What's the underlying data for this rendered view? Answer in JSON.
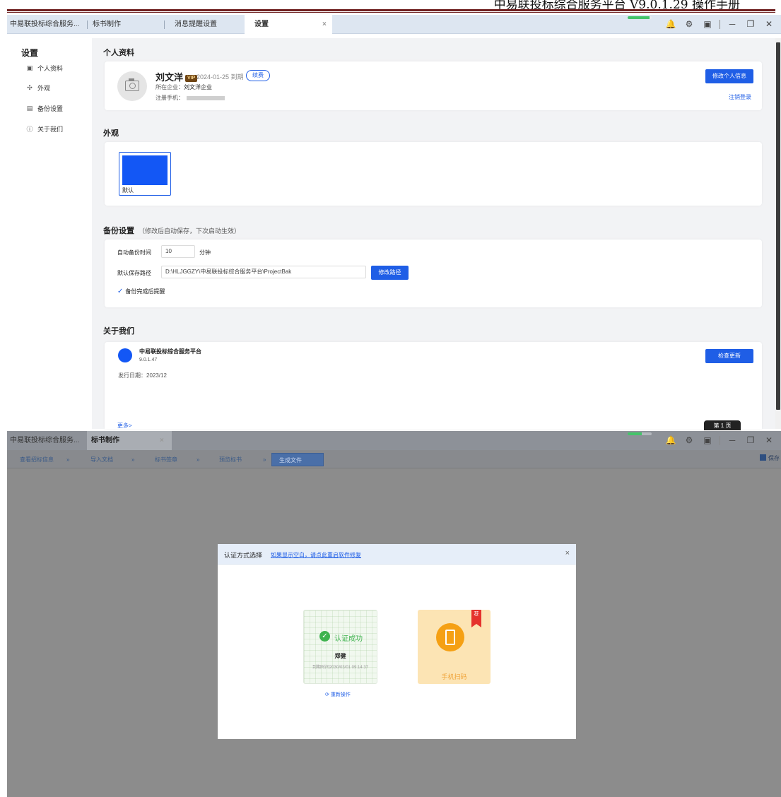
{
  "doc_header": {
    "title": "中易联投标综合服务平台 V9.0.1.29 操作手册"
  },
  "win1": {
    "tabs": [
      {
        "label": "中易联投标综合服务..."
      },
      {
        "label": "标书制作"
      },
      {
        "label": "消息提醒设置"
      },
      {
        "label": "设置",
        "close": "×"
      }
    ],
    "progress_fraction": 0.9,
    "controls": {
      "bell": "🔔",
      "gear": "⚙",
      "box": "▣",
      "minimize": "─",
      "restore": "❐",
      "close": "✕"
    }
  },
  "settings": {
    "title": "设置",
    "menu": [
      {
        "label": "个人资料",
        "icon": "▣"
      },
      {
        "label": "外观",
        "icon": "✣"
      },
      {
        "label": "备份设置",
        "icon": "▤"
      },
      {
        "label": "关于我们",
        "icon": "ⓘ"
      }
    ]
  },
  "profile": {
    "section_title": "个人资料",
    "name": "刘文洋",
    "vip_badge": "VIP",
    "expire": "2024-01-25 到期",
    "renew_button": "续费",
    "company_label": "所在企业：",
    "company": "刘文洋企业",
    "phone_label": "注册手机：",
    "edit_button": "修改个人信息",
    "logout_link": "注销登录"
  },
  "appearance": {
    "section_title": "外观",
    "theme_label": "默认",
    "theme_color": "#1357f5"
  },
  "backup": {
    "section_title": "备份设置",
    "note": "（修改后自动保存，下次启动生效）",
    "auto_label": "自动备份时间",
    "auto_value": "10",
    "auto_unit": "分钟",
    "path_label": "默认保存路径",
    "path_value": "D:\\HLJGGZY\\中易联投标综合服务平台\\ProjectBak",
    "change_path_button": "修改路径",
    "remind_label": "备份完成后提醒",
    "remind_checked": true
  },
  "about": {
    "section_title": "关于我们",
    "app_name": "中易联投标综合服务平台",
    "version": "9.0.1.47",
    "release_date": "发行日期：2023/12",
    "check_update_button": "检查更新",
    "more_link": "更多>",
    "tooltip_partial": "第 1 页"
  },
  "win2": {
    "tabs": [
      {
        "label": "中易联投标综合服务..."
      },
      {
        "label": "标书制作",
        "close": "×"
      }
    ],
    "progress_fraction": 0.6,
    "steps": [
      {
        "label": "查看招标信息"
      },
      {
        "label": "导入文档"
      },
      {
        "label": "标书签章"
      },
      {
        "label": "预览标书"
      },
      {
        "label": "生成文件",
        "current": true
      }
    ],
    "step_arrow": "»",
    "save_label": "保存"
  },
  "auth_modal": {
    "title": "认证方式选择",
    "repair_link": "如果显示空白，请点此重启软件修复",
    "close": "×",
    "success_card": {
      "status": "认证成功",
      "name": "郑健",
      "expire": "到期时间2030/03/01 09:14:37",
      "redo_link": "重新操作"
    },
    "scan_card": {
      "label": "手机扫码",
      "ribbon": "荐"
    }
  },
  "colors": {
    "brand_blue": "#1f5ee6",
    "success_green": "#3fb34f",
    "scan_orange": "#f5a014",
    "header_rule": "#6e1f1f"
  }
}
